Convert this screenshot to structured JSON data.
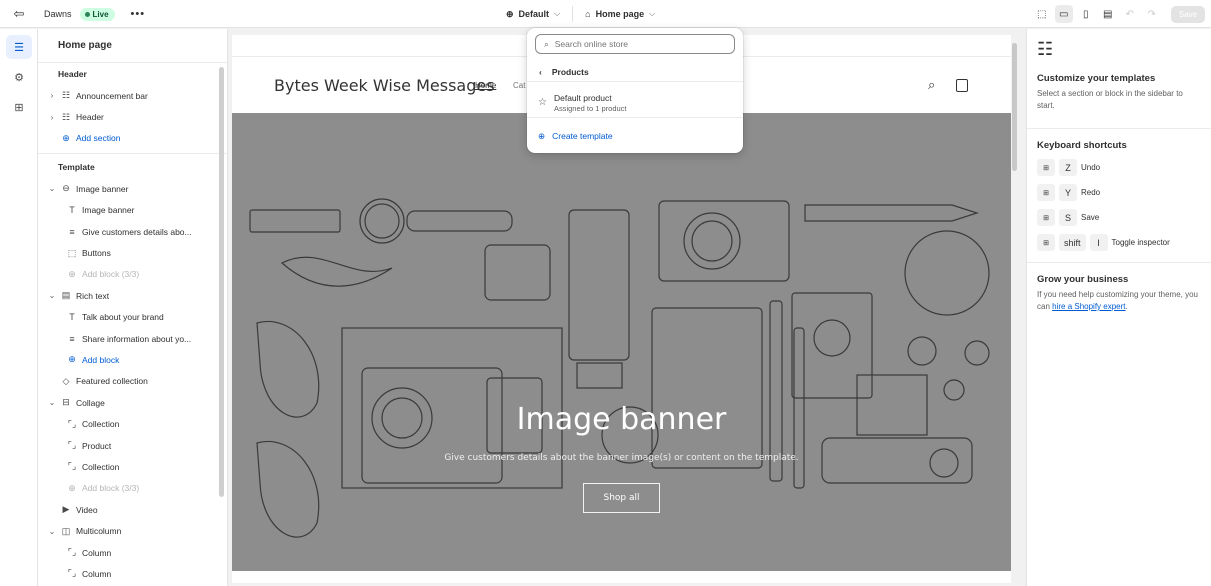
{
  "topbar": {
    "theme_name": "Dawns",
    "live_label": "Live",
    "more_label": "•••",
    "template_context": "Default",
    "page_context": "Home page",
    "save_label": "Save"
  },
  "sidebar": {
    "title": "Home page",
    "header_group": "Header",
    "header_items": [
      {
        "label": "Announcement bar"
      },
      {
        "label": "Header"
      }
    ],
    "add_section": "Add section",
    "template_group": "Template",
    "template_items": [
      {
        "label": "Image banner"
      },
      {
        "label": "Image banner"
      },
      {
        "label": "Give customers details abo..."
      },
      {
        "label": "Buttons"
      },
      {
        "label": "Add block (3/3)"
      },
      {
        "label": "Rich text"
      },
      {
        "label": "Talk about your brand"
      },
      {
        "label": "Share information about yo..."
      },
      {
        "label": "Add block"
      },
      {
        "label": "Featured collection"
      },
      {
        "label": "Collage"
      },
      {
        "label": "Collection"
      },
      {
        "label": "Product"
      },
      {
        "label": "Collection"
      },
      {
        "label": "Add block (3/3)"
      },
      {
        "label": "Video"
      },
      {
        "label": "Multicolumn"
      },
      {
        "label": "Column"
      },
      {
        "label": "Column"
      }
    ]
  },
  "preview": {
    "store_name": "Bytes Week Wise Messages",
    "nav_home": "Home",
    "nav_catalog": "Cat",
    "banner_title": "Image banner",
    "banner_subtitle": "Give customers details about the banner image(s) or content on the template.",
    "banner_button": "Shop all"
  },
  "dropdown": {
    "search_placeholder": "Search online store",
    "back_label": "Products",
    "item_title": "Default product",
    "item_subtitle": "Assigned to 1 product",
    "create_label": "Create template"
  },
  "right_panel": {
    "customize_title": "Customize your templates",
    "customize_text": "Select a section or block in the sidebar to start.",
    "shortcuts_title": "Keyboard shortcuts",
    "shortcuts": [
      {
        "keys": [
          "⊞",
          "Z"
        ],
        "action": "Undo"
      },
      {
        "keys": [
          "⊞",
          "Y"
        ],
        "action": "Redo"
      },
      {
        "keys": [
          "⊞",
          "S"
        ],
        "action": "Save"
      },
      {
        "keys": [
          "⊞",
          "shift",
          "I"
        ],
        "action": "Toggle inspector"
      }
    ],
    "grow_title": "Grow your business",
    "grow_text": "If you need help customizing your theme, you can",
    "grow_link": "hire a Shopify expert",
    "grow_end": "."
  },
  "colors": {
    "accent": "#005bd3",
    "live_bg": "#cdfee1",
    "live_text": "#0c5132",
    "banner_bg": "#8d8d8d"
  }
}
